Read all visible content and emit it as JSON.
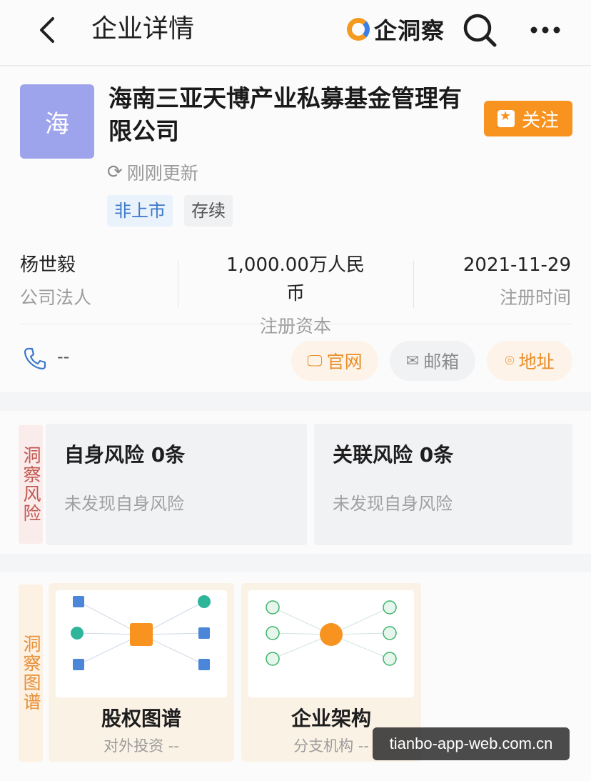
{
  "header": {
    "title": "企业详情",
    "brand": "企洞察"
  },
  "company": {
    "avatar_char": "海",
    "name": "海南三亚天博产业私募基金管理有限公司",
    "follow_label": "关注",
    "update_text": "刚刚更新",
    "tags": [
      "非上市",
      "存续"
    ]
  },
  "stats": [
    {
      "value": "杨世毅",
      "label": "公司法人"
    },
    {
      "value": "1,000.00万人民币",
      "label": "注册资本"
    },
    {
      "value": "2021-11-29",
      "label": "注册时间"
    }
  ],
  "contact": {
    "phone": "--",
    "website_label": "官网",
    "email_label": "邮箱",
    "address_label": "地址"
  },
  "risk": {
    "side_label": "洞察风险",
    "self_title": "自身风险 0条",
    "self_sub": "未发现自身风险",
    "related_title": "关联风险 0条",
    "related_sub": "未发现自身风险"
  },
  "graph": {
    "side_label": "洞察图谱",
    "equity_title": "股权图谱",
    "equity_sub": "对外投资 --",
    "org_title": "企业架构",
    "org_sub": "分支机构 --"
  },
  "watermark": "tianbo-app-web.com.cn",
  "colors": {
    "accent_orange": "#f7931e",
    "avatar_bg": "#9ea4ec",
    "tag_blue": "#3b78c9",
    "risk_red": "#c0574f"
  }
}
